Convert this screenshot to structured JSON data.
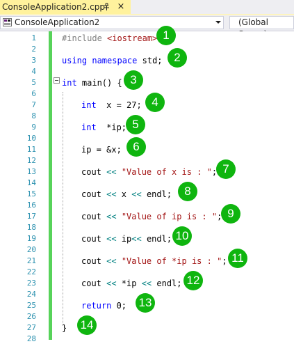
{
  "tab": {
    "label": "ConsoleApplication2.cpp",
    "pin_icon": "pin-icon",
    "close_glyph": "×"
  },
  "navbar": {
    "project": "ConsoleApplication2",
    "scope": "(Global Scope)"
  },
  "colors": {
    "keyword": "#0000ff",
    "string": "#a31515",
    "preprocessor": "#808080",
    "operator": "#008080",
    "line_number": "#2b91af",
    "change_bar": "#57d35a",
    "badge": "#0fb50f",
    "tab_active": "#fff29d"
  },
  "line_numbers": [
    "1",
    "2",
    "3",
    "4",
    "5",
    "6",
    "7",
    "8",
    "9",
    "10",
    "11",
    "12",
    "13",
    "14",
    "15",
    "16",
    "17",
    "18",
    "19",
    "20",
    "21",
    "22",
    "23",
    "24",
    "25",
    "26",
    "27",
    "28"
  ],
  "code": [
    {
      "line": 1,
      "tokens": [
        {
          "t": "#include ",
          "c": "pre"
        },
        {
          "t": "<iostream>",
          "c": "inc"
        }
      ]
    },
    {
      "line": 3,
      "tokens": [
        {
          "t": "using",
          "c": "kw"
        },
        {
          "t": " ",
          "c": "plain"
        },
        {
          "t": "namespace",
          "c": "kw"
        },
        {
          "t": " std;",
          "c": "plain"
        }
      ]
    },
    {
      "line": 5,
      "tokens": [
        {
          "t": "int",
          "c": "kw"
        },
        {
          "t": " main() {",
          "c": "plain"
        }
      ]
    },
    {
      "line": 7,
      "tokens": [
        {
          "t": "int",
          "c": "kw"
        },
        {
          "t": "  x = 27;",
          "c": "plain"
        }
      ]
    },
    {
      "line": 9,
      "tokens": [
        {
          "t": "int",
          "c": "kw"
        },
        {
          "t": "  *ip;",
          "c": "plain"
        }
      ]
    },
    {
      "line": 11,
      "tokens": [
        {
          "t": "ip = &x;",
          "c": "plain"
        }
      ]
    },
    {
      "line": 13,
      "tokens": [
        {
          "t": "cout ",
          "c": "plain"
        },
        {
          "t": "<<",
          "c": "op"
        },
        {
          "t": " ",
          "c": "plain"
        },
        {
          "t": "\"Value of x is : \"",
          "c": "str"
        },
        {
          "t": ";",
          "c": "plain"
        }
      ]
    },
    {
      "line": 15,
      "tokens": [
        {
          "t": "cout ",
          "c": "plain"
        },
        {
          "t": "<<",
          "c": "op"
        },
        {
          "t": " x ",
          "c": "plain"
        },
        {
          "t": "<<",
          "c": "op"
        },
        {
          "t": " endl;",
          "c": "plain"
        }
      ]
    },
    {
      "line": 17,
      "tokens": [
        {
          "t": "cout ",
          "c": "plain"
        },
        {
          "t": "<<",
          "c": "op"
        },
        {
          "t": " ",
          "c": "plain"
        },
        {
          "t": "\"Value of ip is : \"",
          "c": "str"
        },
        {
          "t": ";",
          "c": "plain"
        }
      ]
    },
    {
      "line": 19,
      "tokens": [
        {
          "t": "cout ",
          "c": "plain"
        },
        {
          "t": "<<",
          "c": "op"
        },
        {
          "t": " ip",
          "c": "plain"
        },
        {
          "t": "<<",
          "c": "op"
        },
        {
          "t": " endl;",
          "c": "plain"
        }
      ]
    },
    {
      "line": 21,
      "tokens": [
        {
          "t": "cout ",
          "c": "plain"
        },
        {
          "t": "<<",
          "c": "op"
        },
        {
          "t": " ",
          "c": "plain"
        },
        {
          "t": "\"Value of *ip is : \"",
          "c": "str"
        },
        {
          "t": ";",
          "c": "plain"
        }
      ]
    },
    {
      "line": 23,
      "tokens": [
        {
          "t": "cout ",
          "c": "plain"
        },
        {
          "t": "<<",
          "c": "op"
        },
        {
          "t": " *ip ",
          "c": "plain"
        },
        {
          "t": "<<",
          "c": "op"
        },
        {
          "t": " endl;",
          "c": "plain"
        }
      ]
    },
    {
      "line": 25,
      "tokens": [
        {
          "t": "return",
          "c": "kw"
        },
        {
          "t": " 0;",
          "c": "plain"
        }
      ]
    },
    {
      "line": 27,
      "tokens": [
        {
          "t": "}",
          "c": "plain"
        }
      ]
    }
  ],
  "badges": [
    "1",
    "2",
    "3",
    "4",
    "5",
    "6",
    "7",
    "8",
    "9",
    "10",
    "11",
    "12",
    "13",
    "14"
  ]
}
